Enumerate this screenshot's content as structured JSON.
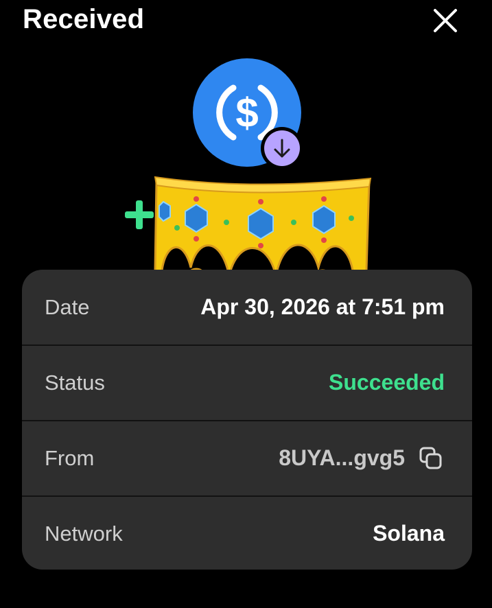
{
  "header": {
    "title": "Received",
    "close_icon": "close-icon"
  },
  "hero": {
    "token_icon": "usdc-coin-icon",
    "token_symbol": "$",
    "badge_icon": "arrow-down-icon",
    "overlay_icon": "crown-sticker",
    "colors": {
      "token_bg": "#2f87f0",
      "badge_bg": "#b7a3ff",
      "crown_gold": "#f6c90e",
      "gem_blue": "#2b7fd6",
      "plus_green": "#3ee08e"
    }
  },
  "details": {
    "rows": [
      {
        "label": "Date",
        "value": "Apr 30, 2026 at 7:51 pm"
      },
      {
        "label": "Status",
        "value": "Succeeded"
      },
      {
        "label": "From",
        "value": "8UYA...gvg5",
        "icon": "copy-icon"
      },
      {
        "label": "Network",
        "value": "Solana"
      }
    ],
    "colors": {
      "card_bg": "#2e2e2e",
      "success": "#3ee08e"
    }
  }
}
